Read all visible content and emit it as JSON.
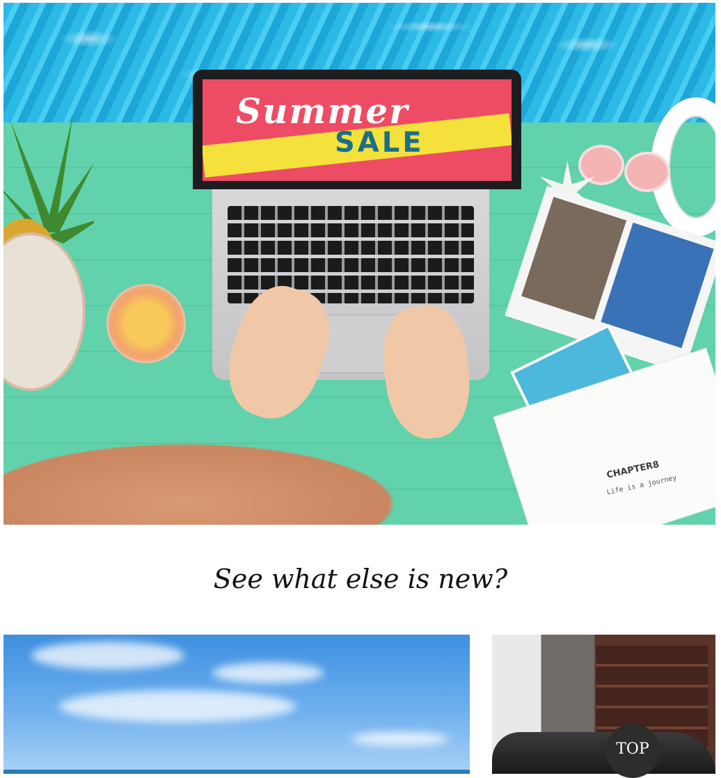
{
  "hero": {
    "image_label": "Summer Sale laptop hero image",
    "screen_line1": "Summer",
    "screen_line2": "SALE",
    "book_heading": "CHAPTER8",
    "book_subheading": "Life is a journey"
  },
  "section": {
    "heading": "See what else is new?"
  },
  "thumbnails": [
    {
      "label": "Beach sky thumbnail"
    },
    {
      "label": "City street thumbnail"
    }
  ],
  "top_button": {
    "label": "TOP"
  },
  "colors": {
    "pool": "#2bb9e6",
    "deck": "#62d2ac",
    "sale_screen": "#ee4c64",
    "sale_yellow": "#f4e13b",
    "top_button_bg": "#2d2d2d"
  }
}
